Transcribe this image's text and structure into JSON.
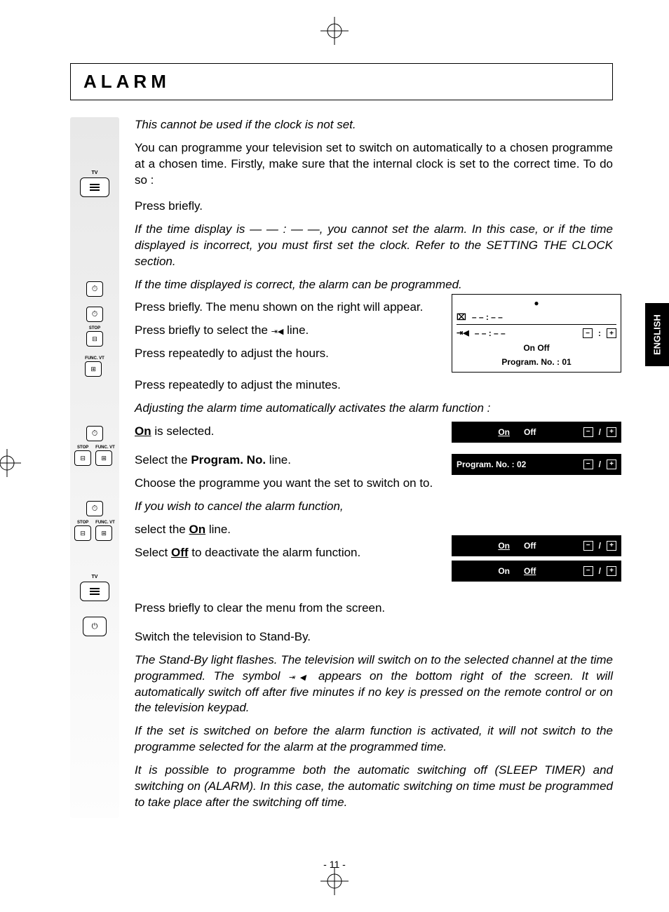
{
  "heading": "ALARM",
  "langTab": "ENGLISH",
  "pageNumber": "- 11 -",
  "intro": {
    "note": "This cannot be used if the clock is not set.",
    "body": "You can programme your television set to switch on automatically to a chosen programme at a chosen time. Firstly, make sure that the internal clock is set to the correct time. To do so :"
  },
  "steps": {
    "pressBriefly1": "Press briefly.",
    "timeWarning": "If the time display is — — : — —, you cannot set the alarm. In this case, or if the time displayed is incorrect, you must first set the clock. Refer to the SETTING THE CLOCK section.",
    "timeOk": "If the time displayed is correct, the alarm can be programmed.",
    "menuAppear": "Press briefly. The menu shown on the right will appear.",
    "selectLinePrefix": "Press briefly to select the ",
    "selectLineSuffix": " line.",
    "adjustHours": "Press repeatedly to adjust the hours.",
    "adjustMinutes": "Press repeatedly to adjust the minutes.",
    "autoActivate": "Adjusting the alarm time automatically activates the alarm function :",
    "onSelectedPre": "On",
    "onSelectedPost": " is selected.",
    "selectProgLinePre": "Select the ",
    "selectProgLineBold": "Program. No.",
    "selectProgLinePost": " line.",
    "chooseProg": "Choose the programme you want the set to switch on to.",
    "cancelNote": "If you wish to cancel the alarm function,",
    "selectOnPre": "select the ",
    "selectOnBold": "On",
    "selectOnPost": " line.",
    "selectOffPre": "Select  ",
    "selectOffBold": "Off",
    "selectOffPost": " to deactivate the alarm function.",
    "clearMenu": "Press briefly to clear the menu from the screen.",
    "standby": "Switch the television to Stand-By.",
    "standbyNotePre": "The Stand-By light flashes. The television will switch on to the selected channel at the time programmed. The symbol ",
    "standbyNotePost": " appears on the bottom right of the screen. It will automatically switch off after five minutes if no key is pressed on the remote control or on the television keypad.",
    "noSwitchNote": "If the set is switched on before the alarm function is activated, it will not switch to the programme selected for the alarm at the programmed time.",
    "bothNote": "It is possible to programme both the automatic switching off (SLEEP TIMER) and switching on (ALARM). In this case, the automatic switching on time must be programmed to take place after the switching off time."
  },
  "osd": {
    "clock": "– – : – –",
    "alarm": "– – : – –",
    "onOff": "On    Off",
    "progLine": "Program. No. : 01",
    "rowOnOff": "Off",
    "rowOnOffOn": "On",
    "rowProg": "Program. No. : 02",
    "rowOnOff2On": "On",
    "rowOnOff2Off": "Off",
    "colonBox": ":",
    "slash": "/",
    "minus": "−",
    "plus": "+"
  },
  "iconLabels": {
    "tv": "TV",
    "stop": "STOP",
    "funcVt": "FUNC. VT"
  }
}
